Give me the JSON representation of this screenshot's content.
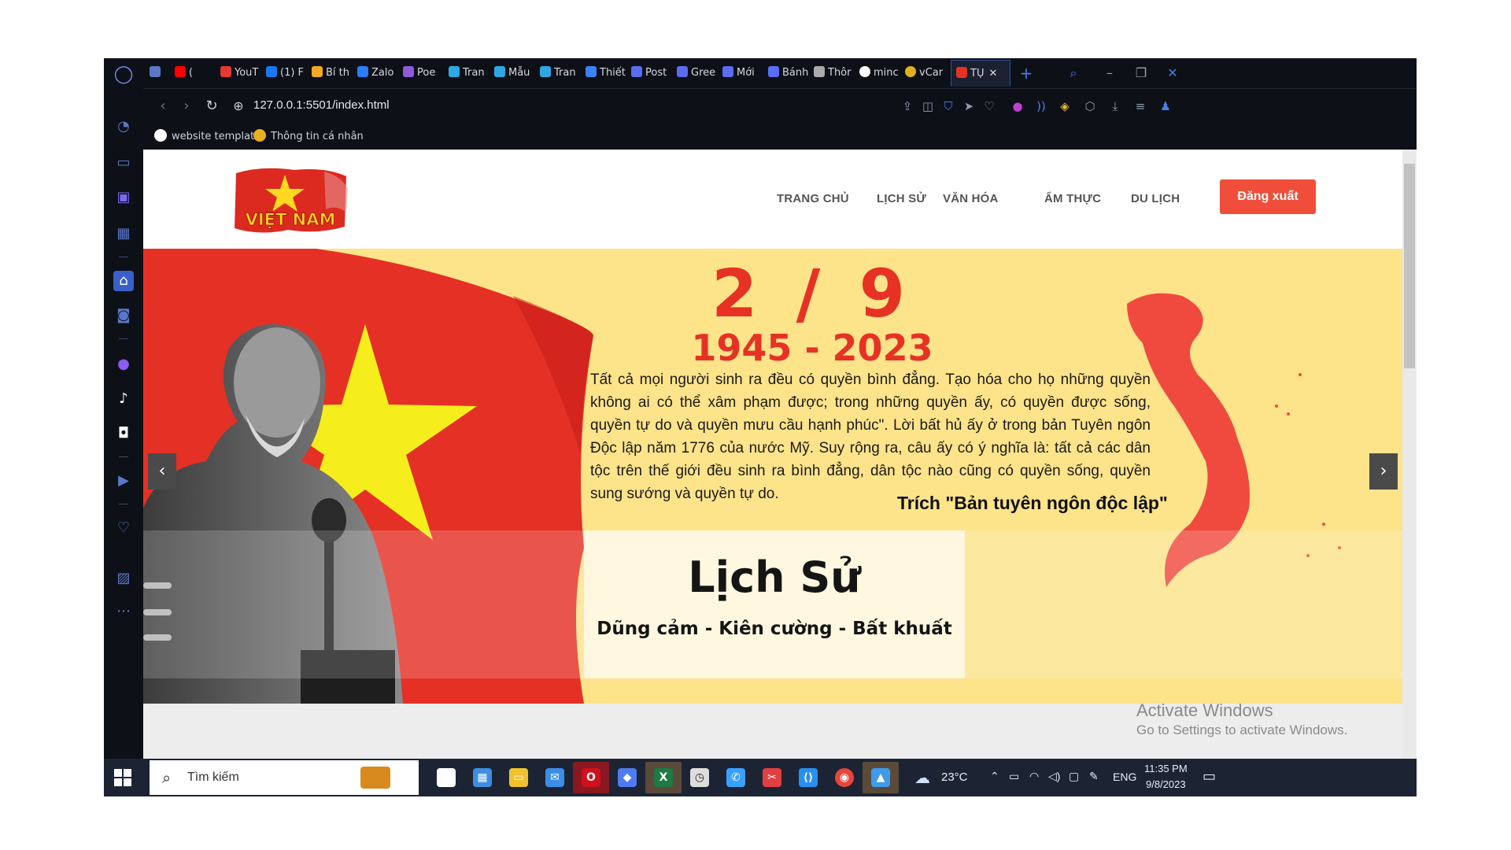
{
  "browser": {
    "tabs": [
      {
        "label": "",
        "icon": "gamepad-icon",
        "color": "#5a78c8"
      },
      {
        "label": "(",
        "icon": "youtube-icon",
        "color": "#ff0000"
      },
      {
        "label": "YouT",
        "icon": "download-icon",
        "color": "#e53935"
      },
      {
        "label": "(1) F",
        "icon": "facebook-icon",
        "color": "#1877f2"
      },
      {
        "label": "Bí th",
        "icon": "emoji-icon",
        "color": "#f5a623"
      },
      {
        "label": "Zalo",
        "icon": "zalo-icon",
        "color": "#2b7bff"
      },
      {
        "label": "Poe",
        "icon": "poe-icon",
        "color": "#8e5bd9"
      },
      {
        "label": "Tran",
        "icon": "canva-icon",
        "color": "#2ea8e5"
      },
      {
        "label": "Mẫu",
        "icon": "canva-icon",
        "color": "#2ea8e5"
      },
      {
        "label": "Tran",
        "icon": "canva-icon",
        "color": "#2ea8e5"
      },
      {
        "label": "Thiết",
        "icon": "page-icon",
        "color": "#3b82f6"
      },
      {
        "label": "Post",
        "icon": "page-icon",
        "color": "#5b6cf0"
      },
      {
        "label": "Gree",
        "icon": "page-icon",
        "color": "#5b6cf0"
      },
      {
        "label": "Mới",
        "icon": "page-icon",
        "color": "#5b6cf0"
      },
      {
        "label": "Bánh",
        "icon": "heart-icon",
        "color": "#5a6ef5"
      },
      {
        "label": "Thôr",
        "icon": "slash-icon",
        "color": "#aaaaaa"
      },
      {
        "label": "minc",
        "icon": "google-icon",
        "color": "#ffffff"
      },
      {
        "label": "vCar",
        "icon": "coin-icon",
        "color": "#e0b020"
      },
      {
        "label": "TỤ",
        "icon": "flag-icon",
        "color": "#e63224",
        "active": true
      }
    ],
    "url": "127.0.0.1:5501/index.html",
    "bookmarks": [
      {
        "label": "website template",
        "icon": "github-icon"
      },
      {
        "label": "Thông tin cá nhân",
        "icon": "coin-icon"
      }
    ]
  },
  "site": {
    "logo_text": "VIỆT NAM",
    "menu": [
      "TRANG CHỦ",
      "LỊCH SỬ",
      "VĂN HÓA",
      "ẨM THỰC",
      "DU LỊCH"
    ],
    "logout_label": "Đăng xuất",
    "hero": {
      "date": "2 / 9",
      "years": "1945 - 2023",
      "quote": "Tất cả mọi người sinh ra đều có quyền bình đẳng. Tạo hóa cho họ những quyền không ai có thể xâm phạm được; trong những quyền ấy, có quyền được sống, quyền tự do và quyền mưu cầu hạnh phúc\". Lời bất hủ ấy ở trong bản Tuyên ngôn Độc lập năm 1776 của nước Mỹ. Suy rộng ra, câu ấy có ý nghĩa là: tất cả các dân tộc trên thế giới đều sinh ra bình đẳng, dân tộc nào cũng có quyền sống, quyền sung sướng và quyền tự do.",
      "source": "Trích \"Bản tuyên ngôn độc lập\"",
      "card_title": "Lịch Sử",
      "card_subtitle": "Dũng cảm - Kiên cường - Bất khuất",
      "prev_icon": "chevron-left-icon",
      "next_icon": "chevron-right-icon"
    }
  },
  "watermark": {
    "title": "Activate Windows",
    "subtitle": "Go to Settings to activate Windows."
  },
  "taskbar": {
    "search_placeholder": "Tìm kiếm",
    "weather": "23°C",
    "language": "ENG",
    "time": "11:35 PM",
    "date": "9/8/2023",
    "apps": [
      {
        "name": "briefcase-icon",
        "color": "#d98a1e"
      },
      {
        "name": "task-view-icon",
        "color": "#ffffff"
      },
      {
        "name": "store-icon",
        "color": "#3d8de0"
      },
      {
        "name": "file-explorer-icon",
        "color": "#f2c12e"
      },
      {
        "name": "mail-icon",
        "color": "#3b8ee6"
      },
      {
        "name": "opera-icon",
        "color": "#d0101a"
      },
      {
        "name": "copilot-icon",
        "color": "#4e7cf0"
      },
      {
        "name": "excel-icon",
        "color": "#1e7a44"
      },
      {
        "name": "clock-icon",
        "color": "#dddddd"
      },
      {
        "name": "messenger-icon",
        "color": "#3aa0ff"
      },
      {
        "name": "snip-icon",
        "color": "#e04040"
      },
      {
        "name": "vscode-icon",
        "color": "#2a8ff0"
      },
      {
        "name": "chrome-icon",
        "color": "#e8453c"
      },
      {
        "name": "photos-icon",
        "color": "#3d9be9"
      }
    ]
  }
}
